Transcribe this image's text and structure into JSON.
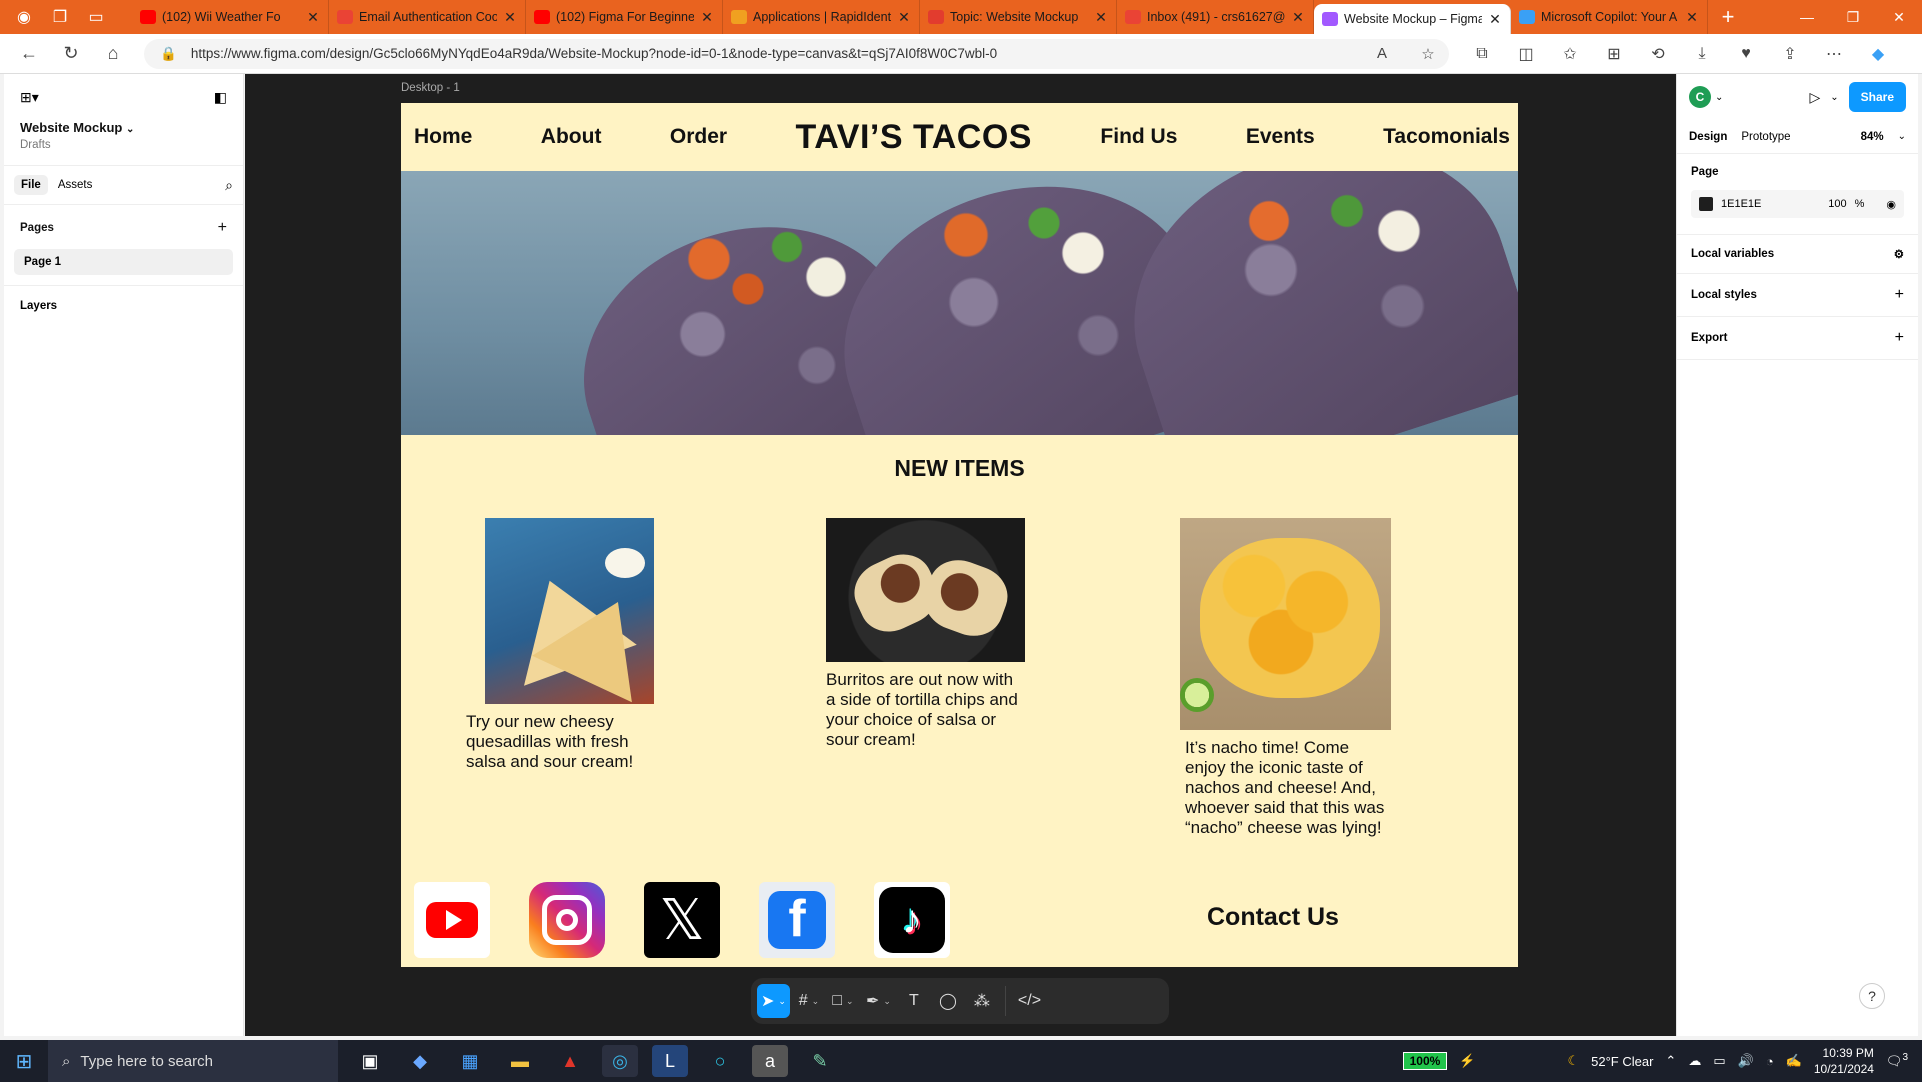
{
  "browser": {
    "tabs": [
      {
        "title": "(102) Wii Weather Fo",
        "favicon": "youtube",
        "color": "#ff0000"
      },
      {
        "title": "Email Authentication Coo",
        "favicon": "gmail",
        "color": "#ea4335"
      },
      {
        "title": "(102) Figma For Beginner",
        "favicon": "youtube",
        "color": "#ff0000"
      },
      {
        "title": "Applications | RapidIdent",
        "favicon": "rapididentity",
        "color": "#f0a020"
      },
      {
        "title": "Topic: Website Mockup",
        "favicon": "canvas",
        "color": "#e23c2e"
      },
      {
        "title": "Inbox (491) - crs61627@",
        "favicon": "gmail",
        "color": "#ea4335"
      },
      {
        "title": "Website Mockup – Figma",
        "favicon": "figma",
        "color": "#a259ff",
        "active": true
      },
      {
        "title": "Microsoft Copilot: Your A",
        "favicon": "copilot",
        "color": "#3aa0f5"
      }
    ],
    "url": "https://www.figma.com/design/Gc5clo66MyNYqdEo4aR9da/Website-Mockup?node-id=0-1&node-type=canvas&t=qSj7AI0f8W0C7wbl-0"
  },
  "figma": {
    "file_name": "Website Mockup",
    "location": "Drafts",
    "left_tabs": [
      "File",
      "Assets"
    ],
    "pages_label": "Pages",
    "current_page": "Page 1",
    "layers_label": "Layers",
    "frame_label": "Desktop - 1",
    "right_tabs": [
      "Design",
      "Prototype"
    ],
    "zoom": "84%",
    "user_initial": "C",
    "share_label": "Share",
    "page_section": "Page",
    "page_color_hex": "1E1E1E",
    "page_opacity": "100",
    "opacity_unit": "%",
    "sections": [
      "Local variables",
      "Local styles",
      "Export"
    ]
  },
  "site": {
    "nav_left": [
      "Home",
      "About",
      "Order"
    ],
    "brand": "TAVI’S TACOS",
    "nav_right": [
      "Find Us",
      "Events",
      "Tacomonials"
    ],
    "section_title": "NEW ITEMS",
    "items": [
      {
        "caption": "Try our new cheesy quesadillas with fresh salsa and sour cream!"
      },
      {
        "caption": "Burritos are out now with a side of tortilla chips and your choice of salsa or sour cream!"
      },
      {
        "caption": "It’s nacho time! Come enjoy the iconic taste of nachos and cheese! And, whoever said that this was “nacho” cheese was lying!"
      }
    ],
    "social": [
      "youtube",
      "instagram",
      "x",
      "facebook",
      "tiktok"
    ],
    "contact": "Contact Us"
  },
  "taskbar": {
    "search_placeholder": "Type here to search",
    "battery": "100%",
    "weather": "52°F  Clear",
    "time": "10:39 PM",
    "date": "10/21/2024",
    "notifications": "3"
  }
}
